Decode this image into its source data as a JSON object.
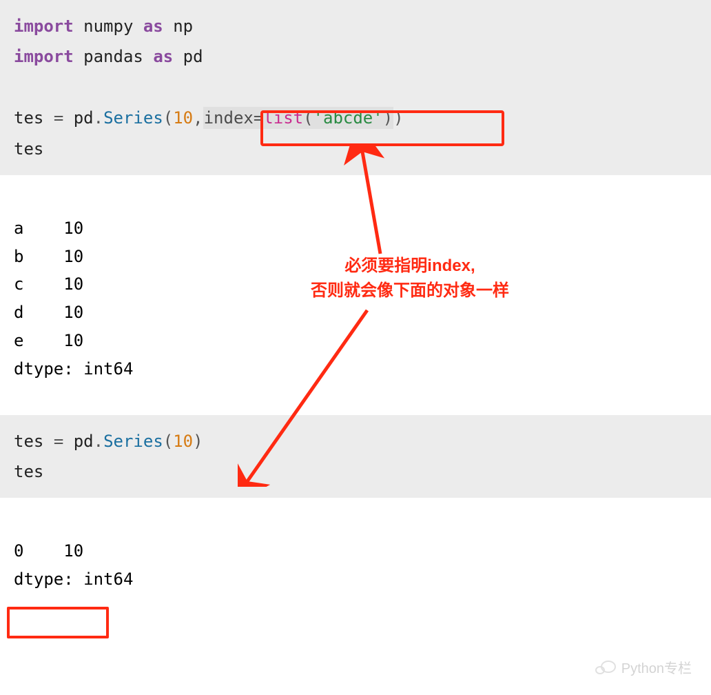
{
  "code1": {
    "line1": {
      "import": "import",
      "lib": "numpy",
      "as": "as",
      "alias": "np"
    },
    "line2": {
      "import": "import",
      "lib": "pandas",
      "as": "as",
      "alias": "pd"
    },
    "line4": {
      "var": "tes",
      "eq": "=",
      "mod": "pd",
      "dot": ".",
      "call": "Series",
      "lp": "(",
      "arg1": "10",
      "comma": ",",
      "kwarg": "index",
      "eq2": "=",
      "fn": "list",
      "lp2": "(",
      "str": "'abcde'",
      "rp2": ")",
      "rp": ")"
    },
    "line5": "tes"
  },
  "output1": {
    "rows": [
      {
        "idx": "a",
        "val": "10"
      },
      {
        "idx": "b",
        "val": "10"
      },
      {
        "idx": "c",
        "val": "10"
      },
      {
        "idx": "d",
        "val": "10"
      },
      {
        "idx": "e",
        "val": "10"
      }
    ],
    "dtype": "dtype: int64"
  },
  "code2": {
    "line1": {
      "var": "tes",
      "eq": "=",
      "mod": "pd",
      "dot": ".",
      "call": "Series",
      "lp": "(",
      "arg1": "10",
      "rp": ")"
    },
    "line2": "tes"
  },
  "output2": {
    "rows": [
      {
        "idx": "0",
        "val": "10"
      }
    ],
    "dtype": "dtype: int64"
  },
  "annotation": {
    "line1": "必须要指明index,",
    "line2": "否则就会像下面的对象一样"
  },
  "watermark": "Python专栏"
}
